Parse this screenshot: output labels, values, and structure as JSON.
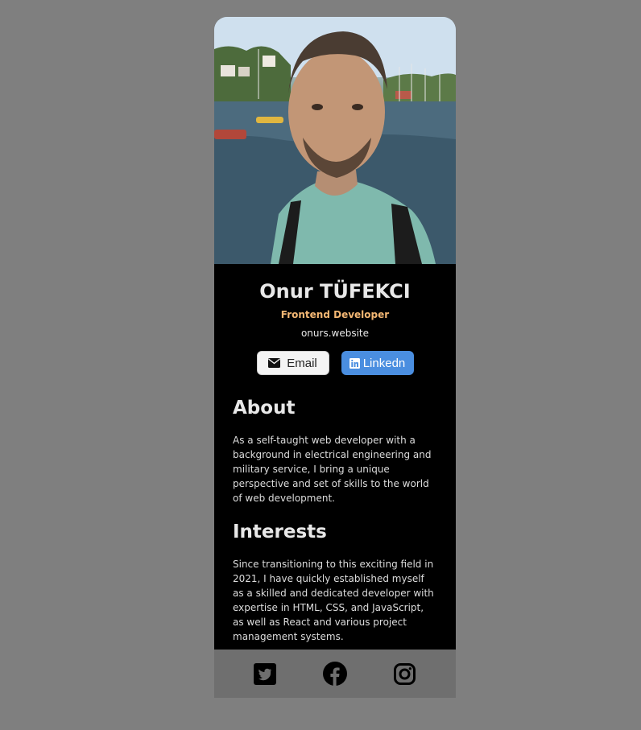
{
  "profile": {
    "name": "Onur TÜFEKCI",
    "role": "Frontend Developer",
    "website": "onurs.website"
  },
  "buttons": {
    "email_label": "Email",
    "linkedin_label": "Linkedn"
  },
  "about": {
    "heading": "About",
    "text": "As a self-taught web developer with a background in electrical engineering and military service, I bring a unique perspective and set of skills to the world of web development."
  },
  "interests": {
    "heading": "Interests",
    "text": "Since transitioning to this exciting field in 2021, I have quickly established myself as a skilled and dedicated developer with expertise in HTML, CSS, and JavaScript, as well as React and various project management systems."
  },
  "footer": {
    "icons": [
      "twitter-icon",
      "facebook-icon",
      "instagram-icon"
    ]
  },
  "colors": {
    "page_background": "#7f7f7f",
    "card_background": "#000000",
    "role_accent": "#f5b874",
    "linkedin_blue": "#4a8ee0",
    "footer_background": "#6f6f6f"
  }
}
